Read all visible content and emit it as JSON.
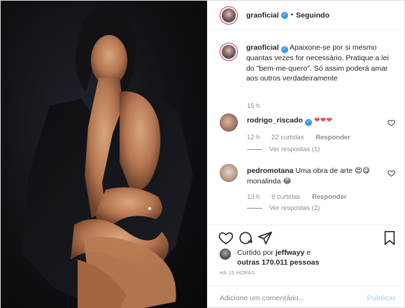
{
  "post": {
    "username": "graoficial",
    "follow_status": "Seguindo",
    "separator": "•"
  },
  "caption": {
    "username": "graoficial",
    "text": "Apaixone-se por si mesmo quantas vezes for necessário. Pratique a lei do \"bem-me-quero\". Só assim poderá amar aos outros verdadeiramente",
    "time": "15 h"
  },
  "comments": [
    {
      "username": "rodrigo_riscado",
      "text": "❤❤❤",
      "time": "12 h",
      "likes": "22 curtidas",
      "reply": "Responder",
      "view_replies": "Ver respostas (1)"
    },
    {
      "username": "pedromotana",
      "text": "Uma obra de arte 😍😋 monalinda 😂",
      "time": "13 h",
      "likes": "6 curtidas",
      "reply": "Responder",
      "view_replies": "Ver respostas (2)"
    }
  ],
  "likes": {
    "prefix": "Curtido por",
    "user": "jeffwayy",
    "and": "e",
    "others": "outras 170.011 pessoas"
  },
  "timestamp": "HÁ 15 HORAS",
  "add_comment": {
    "placeholder": "Adicione um comentário...",
    "publish": "Publicar"
  },
  "colors": {
    "heart": "#ed4956",
    "verified": "#3897f0",
    "publish_disabled": "#b2dffc",
    "meta": "#8e8e8e"
  },
  "icons": [
    "heart-icon",
    "comment-icon",
    "share-icon",
    "bookmark-icon",
    "verified-icon",
    "heart-small-icon"
  ]
}
